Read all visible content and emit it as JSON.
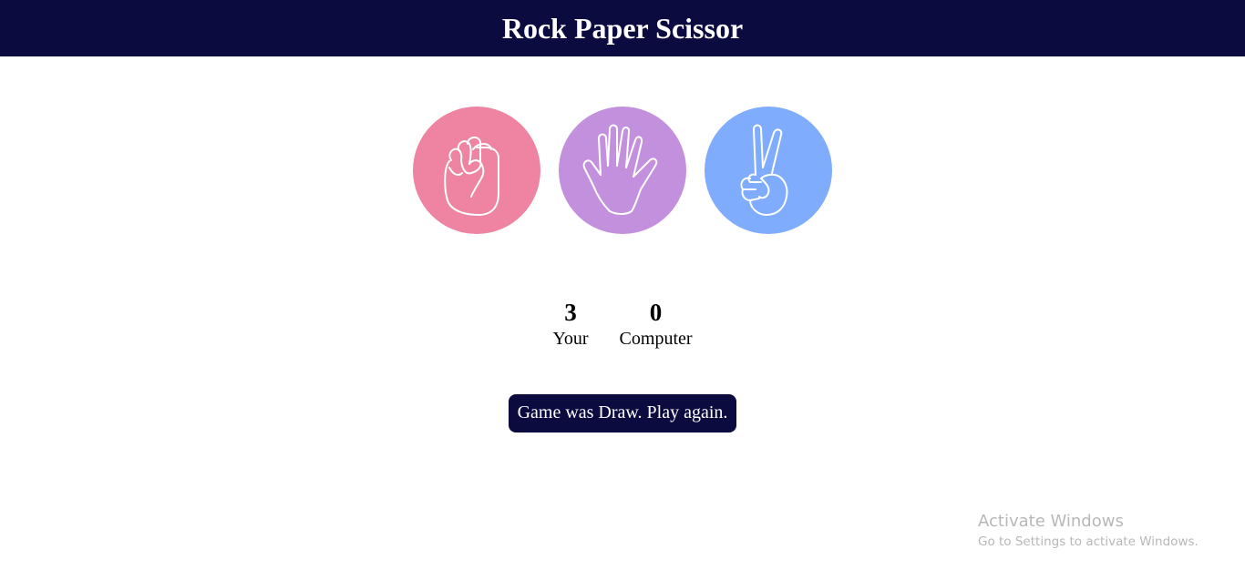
{
  "header": {
    "title": "Rock Paper Scissor"
  },
  "choices": [
    {
      "id": "rock",
      "color": "#ef84a2",
      "icon": "fist-icon"
    },
    {
      "id": "paper",
      "color": "#c390dd",
      "icon": "open-hand-icon"
    },
    {
      "id": "scissors",
      "color": "#80acfd",
      "icon": "peace-hand-icon"
    }
  ],
  "scoreboard": {
    "user": {
      "score": "3",
      "label": "Your"
    },
    "computer": {
      "score": "0",
      "label": "Computer"
    }
  },
  "message": {
    "text": "Game was Draw. Play again.",
    "color": "#0b0b40"
  },
  "watermark": {
    "title": "Activate Windows",
    "subtitle": "Go to Settings to activate Windows."
  }
}
